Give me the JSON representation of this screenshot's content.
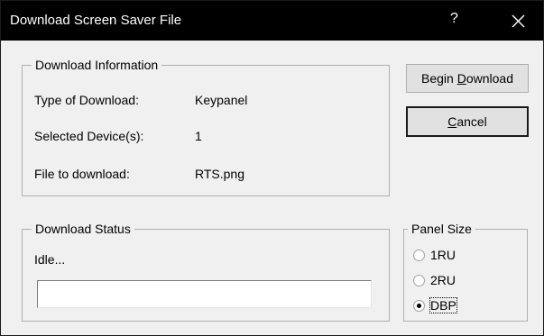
{
  "window": {
    "title": "Download Screen Saver File",
    "help_glyph": "?",
    "close_icon": "close-icon"
  },
  "download_info": {
    "legend": "Download Information",
    "rows": [
      {
        "label": "Type of Download:",
        "value": "Keypanel"
      },
      {
        "label": "Selected Device(s):",
        "value": "1"
      },
      {
        "label": "File to download:",
        "value": "RTS.png"
      }
    ]
  },
  "buttons": {
    "begin_download": {
      "before": "Begin ",
      "accel": "D",
      "after": "ownload"
    },
    "cancel": {
      "before": "",
      "accel": "C",
      "after": "ancel"
    }
  },
  "download_status": {
    "legend": "Download Status",
    "status_text": "Idle...",
    "progress_value": ""
  },
  "panel_size": {
    "legend": "Panel Size",
    "options": [
      {
        "label": "1RU",
        "selected": false
      },
      {
        "label": "2RU",
        "selected": false
      },
      {
        "label": "DBP",
        "selected": true
      }
    ]
  },
  "colors": {
    "titlebar_bg": "#000000",
    "dialog_bg": "#f0f0f0",
    "button_bg": "#e1e1e1"
  }
}
